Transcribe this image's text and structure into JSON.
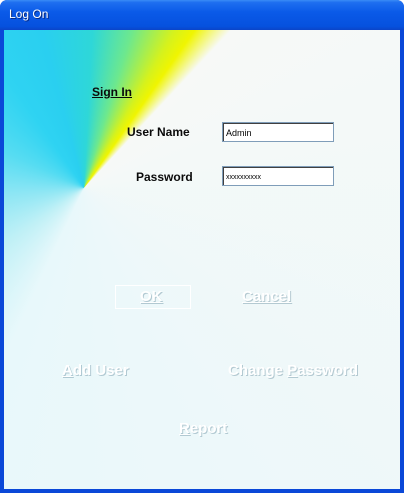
{
  "window": {
    "title": "Log On"
  },
  "form": {
    "heading": "Sign In",
    "username_label": "User Name",
    "username_value": "Admin",
    "password_label": "Password",
    "password_value": "xxxxxxxxxx"
  },
  "buttons": {
    "ok": "OK",
    "cancel": "Cancel",
    "add_user_first": "A",
    "add_user_rest": "dd User",
    "change_password_prefix": "Change ",
    "change_password_first": "P",
    "change_password_rest": "assword",
    "report_first": "R",
    "report_rest": "eport"
  },
  "colors": {
    "title_bar": "#0651de",
    "field_border": "#7f9db9",
    "button_text": "#ffffff"
  }
}
